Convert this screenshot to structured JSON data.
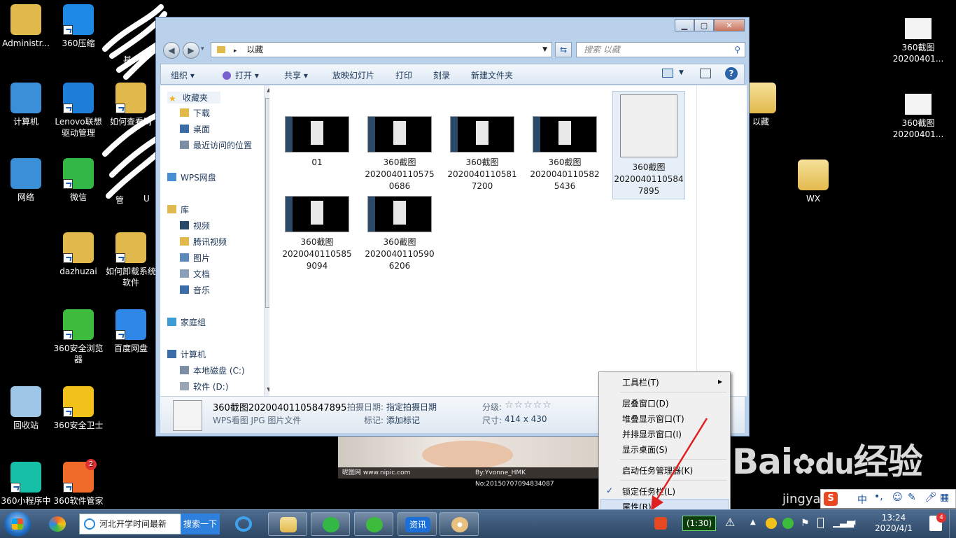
{
  "desktop": {
    "icons_left": [
      {
        "label": "Administr...",
        "color": "#e2b94d"
      },
      {
        "label": "360压缩",
        "color": "#1e88e5"
      },
      {
        "label": "计算机",
        "color": "#3b8fd9"
      },
      {
        "label": "Lenovo联想驱动管理",
        "color": "#1e7fd8"
      },
      {
        "label": "如何查看网",
        "color": "#e2b94d"
      },
      {
        "label": "网络",
        "color": "#3b8fd9"
      },
      {
        "label": "微信",
        "color": "#33b845"
      },
      {
        "label": "dazhuzai",
        "color": "#e2b94d"
      },
      {
        "label": "如何卸载系统软件",
        "color": "#e2b94d"
      },
      {
        "label": "360安全浏览器",
        "color": "#3dbb3d"
      },
      {
        "label": "百度网盘",
        "color": "#2f88e8"
      },
      {
        "label": "回收站",
        "color": "#9ec6e6"
      },
      {
        "label": "360安全卫士",
        "color": "#f2c21a"
      },
      {
        "label": "360小程序中",
        "color": "#16c0a6"
      },
      {
        "label": "360软件管家",
        "color": "#f06a2a"
      }
    ],
    "partial_labels": [
      "基",
      "管",
      "U"
    ],
    "software_badge": "2",
    "icons_right": [
      {
        "label": "360截图\n20200401...",
        "top": "1"
      },
      {
        "label": "360截图\n20200401...",
        "top": "2"
      },
      {
        "label": "以藏"
      },
      {
        "label": "WX"
      }
    ]
  },
  "explorer": {
    "address": "以藏",
    "search_placeholder": "搜索 以藏",
    "toolbar": {
      "organize": "组织 ▾",
      "open": "打开 ▾",
      "share": "共享 ▾",
      "slideshow": "放映幻灯片",
      "print": "打印",
      "burn": "刻录",
      "new_folder": "新建文件夹"
    },
    "nav": [
      {
        "label": "收藏夹",
        "star": true
      },
      {
        "label": "下载"
      },
      {
        "label": "桌面"
      },
      {
        "label": "最近访问的位置"
      },
      {
        "label": "WPS网盘"
      },
      {
        "label": "库"
      },
      {
        "label": "视频"
      },
      {
        "label": "腾讯视频"
      },
      {
        "label": "图片"
      },
      {
        "label": "文档"
      },
      {
        "label": "音乐"
      },
      {
        "label": "家庭组"
      },
      {
        "label": "计算机"
      },
      {
        "label": "本地磁盘 (C:)"
      },
      {
        "label": "软件 (D:)"
      }
    ],
    "files": [
      {
        "name": "01"
      },
      {
        "name": "360截图\n2020040110575\n0686"
      },
      {
        "name": "360截图\n2020040110581\n7200"
      },
      {
        "name": "360截图\n2020040110582\n5436"
      },
      {
        "name": "360截图\n2020040110584\n7895"
      },
      {
        "name": "360截图\n2020040110585\n9094"
      },
      {
        "name": "360截图\n2020040110590\n6206"
      }
    ],
    "details": {
      "filename": "360截图20200401105847895",
      "filetype": "WPS看图 JPG 图片文件",
      "date_label": "拍摄日期:",
      "date_value": "指定拍摄日期",
      "tag_label": "标记:",
      "tag_value": "添加标记",
      "rating_label": "分级:",
      "rating_stars": "☆☆☆☆☆",
      "size_label": "尺寸:",
      "size_value": "414 x 430"
    }
  },
  "bg_photo_caption_left": "昵图网 www.nipic.com",
  "bg_photo_caption_right": "By:Yvonne_HMK No:20150707094834087",
  "context_menu": {
    "toolbars": "工具栏(T)",
    "cascade": "层叠窗口(D)",
    "stack": "堆叠显示窗口(T)",
    "side_by_side": "并排显示窗口(I)",
    "show_desktop": "显示桌面(S)",
    "task_manager": "启动任务管理器(K)",
    "lock_taskbar": "锁定任务栏(L)",
    "properties": "属性(R)",
    "check": "✓",
    "arrow": "▸"
  },
  "taskbar": {
    "search_text": "河北开学时间最新",
    "search_button": "搜索一下",
    "news_label": "资讯",
    "battery_text": "(1:30)",
    "time": "13:24",
    "date": "2020/4/1",
    "notification_count": "4"
  },
  "ime": {
    "lang": "中",
    "punct": "•,",
    "logo": "S"
  },
  "watermark": {
    "brand": "Bai",
    "brand2": "du",
    "jingyan": "经验",
    "url": "jingyan.baidu.com"
  },
  "colors": {
    "taskbar": "#2c4664",
    "accent": "#2f7fdc",
    "highlight": "#d6e4f5",
    "arrow": "#e02020"
  }
}
